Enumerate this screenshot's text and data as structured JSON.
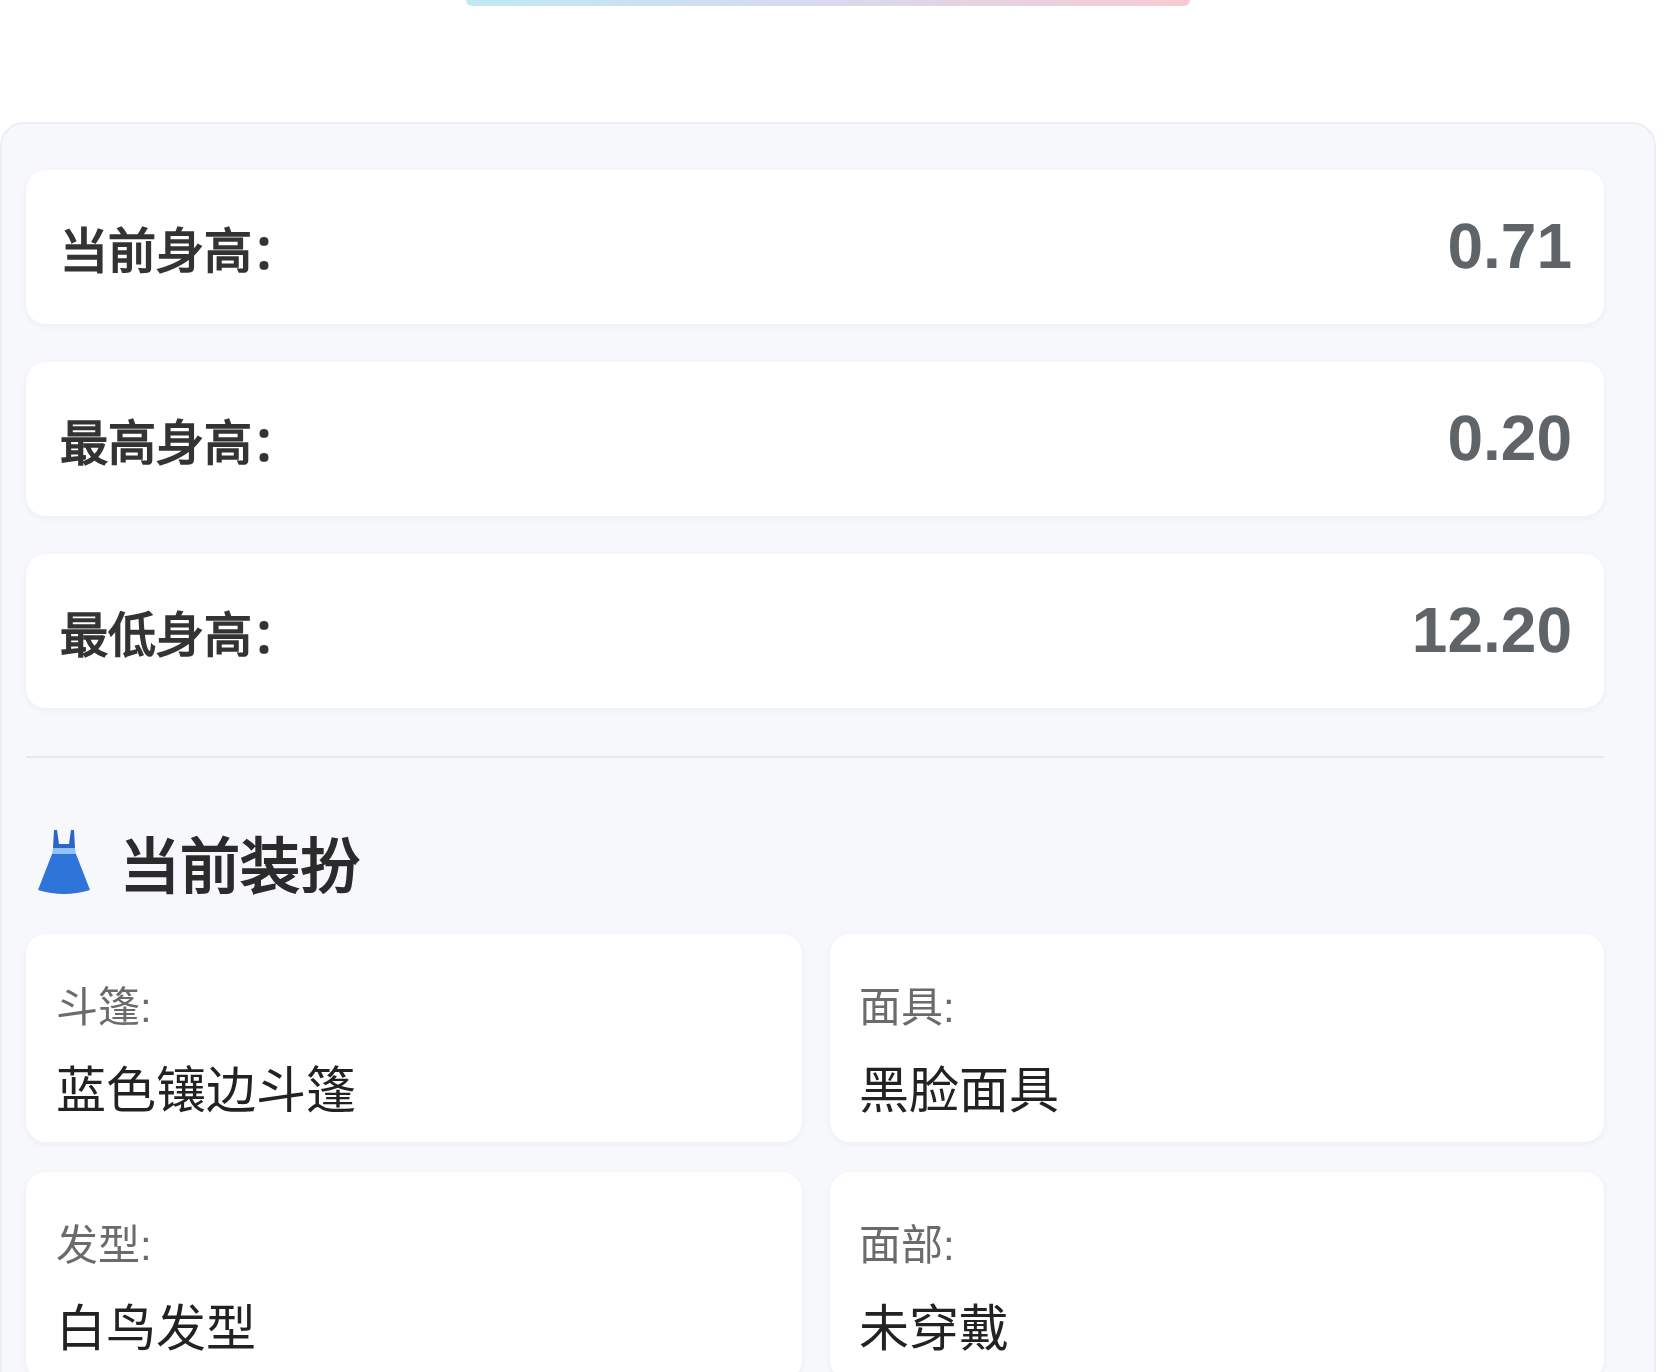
{
  "stats": [
    {
      "label": "当前身高：",
      "value": "0.71"
    },
    {
      "label": "最高身高：",
      "value": "0.20"
    },
    {
      "label": "最低身高：",
      "value": "12.20"
    }
  ],
  "outfit": {
    "title": "当前装扮",
    "items": [
      {
        "label": "斗篷:",
        "value": "蓝色镶边斗篷"
      },
      {
        "label": "面具:",
        "value": "黑脸面具"
      },
      {
        "label": "发型:",
        "value": "白鸟发型"
      },
      {
        "label": "面部:",
        "value": "未穿戴"
      }
    ]
  }
}
